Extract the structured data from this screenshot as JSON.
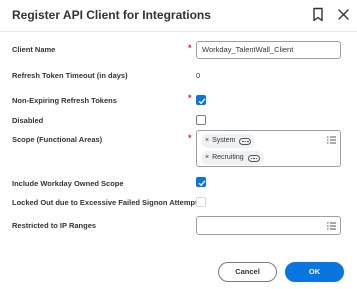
{
  "dialog": {
    "title": "Register API Client for Integrations"
  },
  "fields": {
    "client_name": {
      "label": "Client Name",
      "required": "*",
      "value": "Workday_TalentWall_Client"
    },
    "refresh_timeout": {
      "label": "Refresh Token Timeout (in days)",
      "value": "0"
    },
    "non_expiring": {
      "label": "Non-Expiring Refresh Tokens",
      "required": "*",
      "checked": true
    },
    "disabled": {
      "label": "Disabled",
      "checked": false
    },
    "scope": {
      "label": "Scope (Functional Areas)",
      "required": "*",
      "chips": [
        "System",
        "Recruiting"
      ],
      "chip_remove": "×"
    },
    "include_owned_scope": {
      "label": "Include Workday Owned Scope",
      "checked": true
    },
    "locked_out": {
      "label": "Locked Out due to Excessive Failed Signon Attempts",
      "checked": false,
      "disabled": true
    },
    "restricted_ip": {
      "label": "Restricted to IP Ranges",
      "value": ""
    }
  },
  "buttons": {
    "cancel": "Cancel",
    "ok": "OK"
  },
  "colors": {
    "primary": "#0875e1",
    "required": "#de2a25"
  },
  "icons": {
    "bookmark": "bookmark-icon",
    "close": "close-icon",
    "list": "list-prompt-icon",
    "related_actions": "related-actions-icon"
  }
}
